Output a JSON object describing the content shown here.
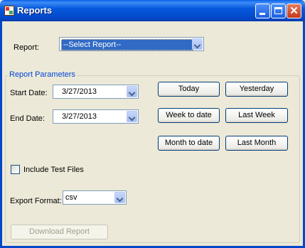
{
  "window": {
    "title": "Reports",
    "min_label": "Minimize",
    "max_label": "Maximize",
    "close_label": "Close"
  },
  "report": {
    "label": "Report:",
    "selected": "--Select Report--"
  },
  "parameters": {
    "group_title": "Report Parameters",
    "start_label": "Start Date:",
    "start_value": "3/27/2013",
    "end_label": "End Date:",
    "end_value": "3/27/2013",
    "buttons": {
      "today": "Today",
      "yesterday": "Yesterday",
      "week_to_date": "Week to date",
      "last_week": "Last Week",
      "month_to_date": "Month to date",
      "last_month": "Last Month"
    },
    "include_test_files": {
      "label": "Include Test Files",
      "checked": false
    },
    "export_label": "Export Format:",
    "export_value": "csv",
    "download_label": "Download Report"
  },
  "icons": {
    "app": "report-app-icon",
    "dropdown": "chevron-down-icon"
  }
}
